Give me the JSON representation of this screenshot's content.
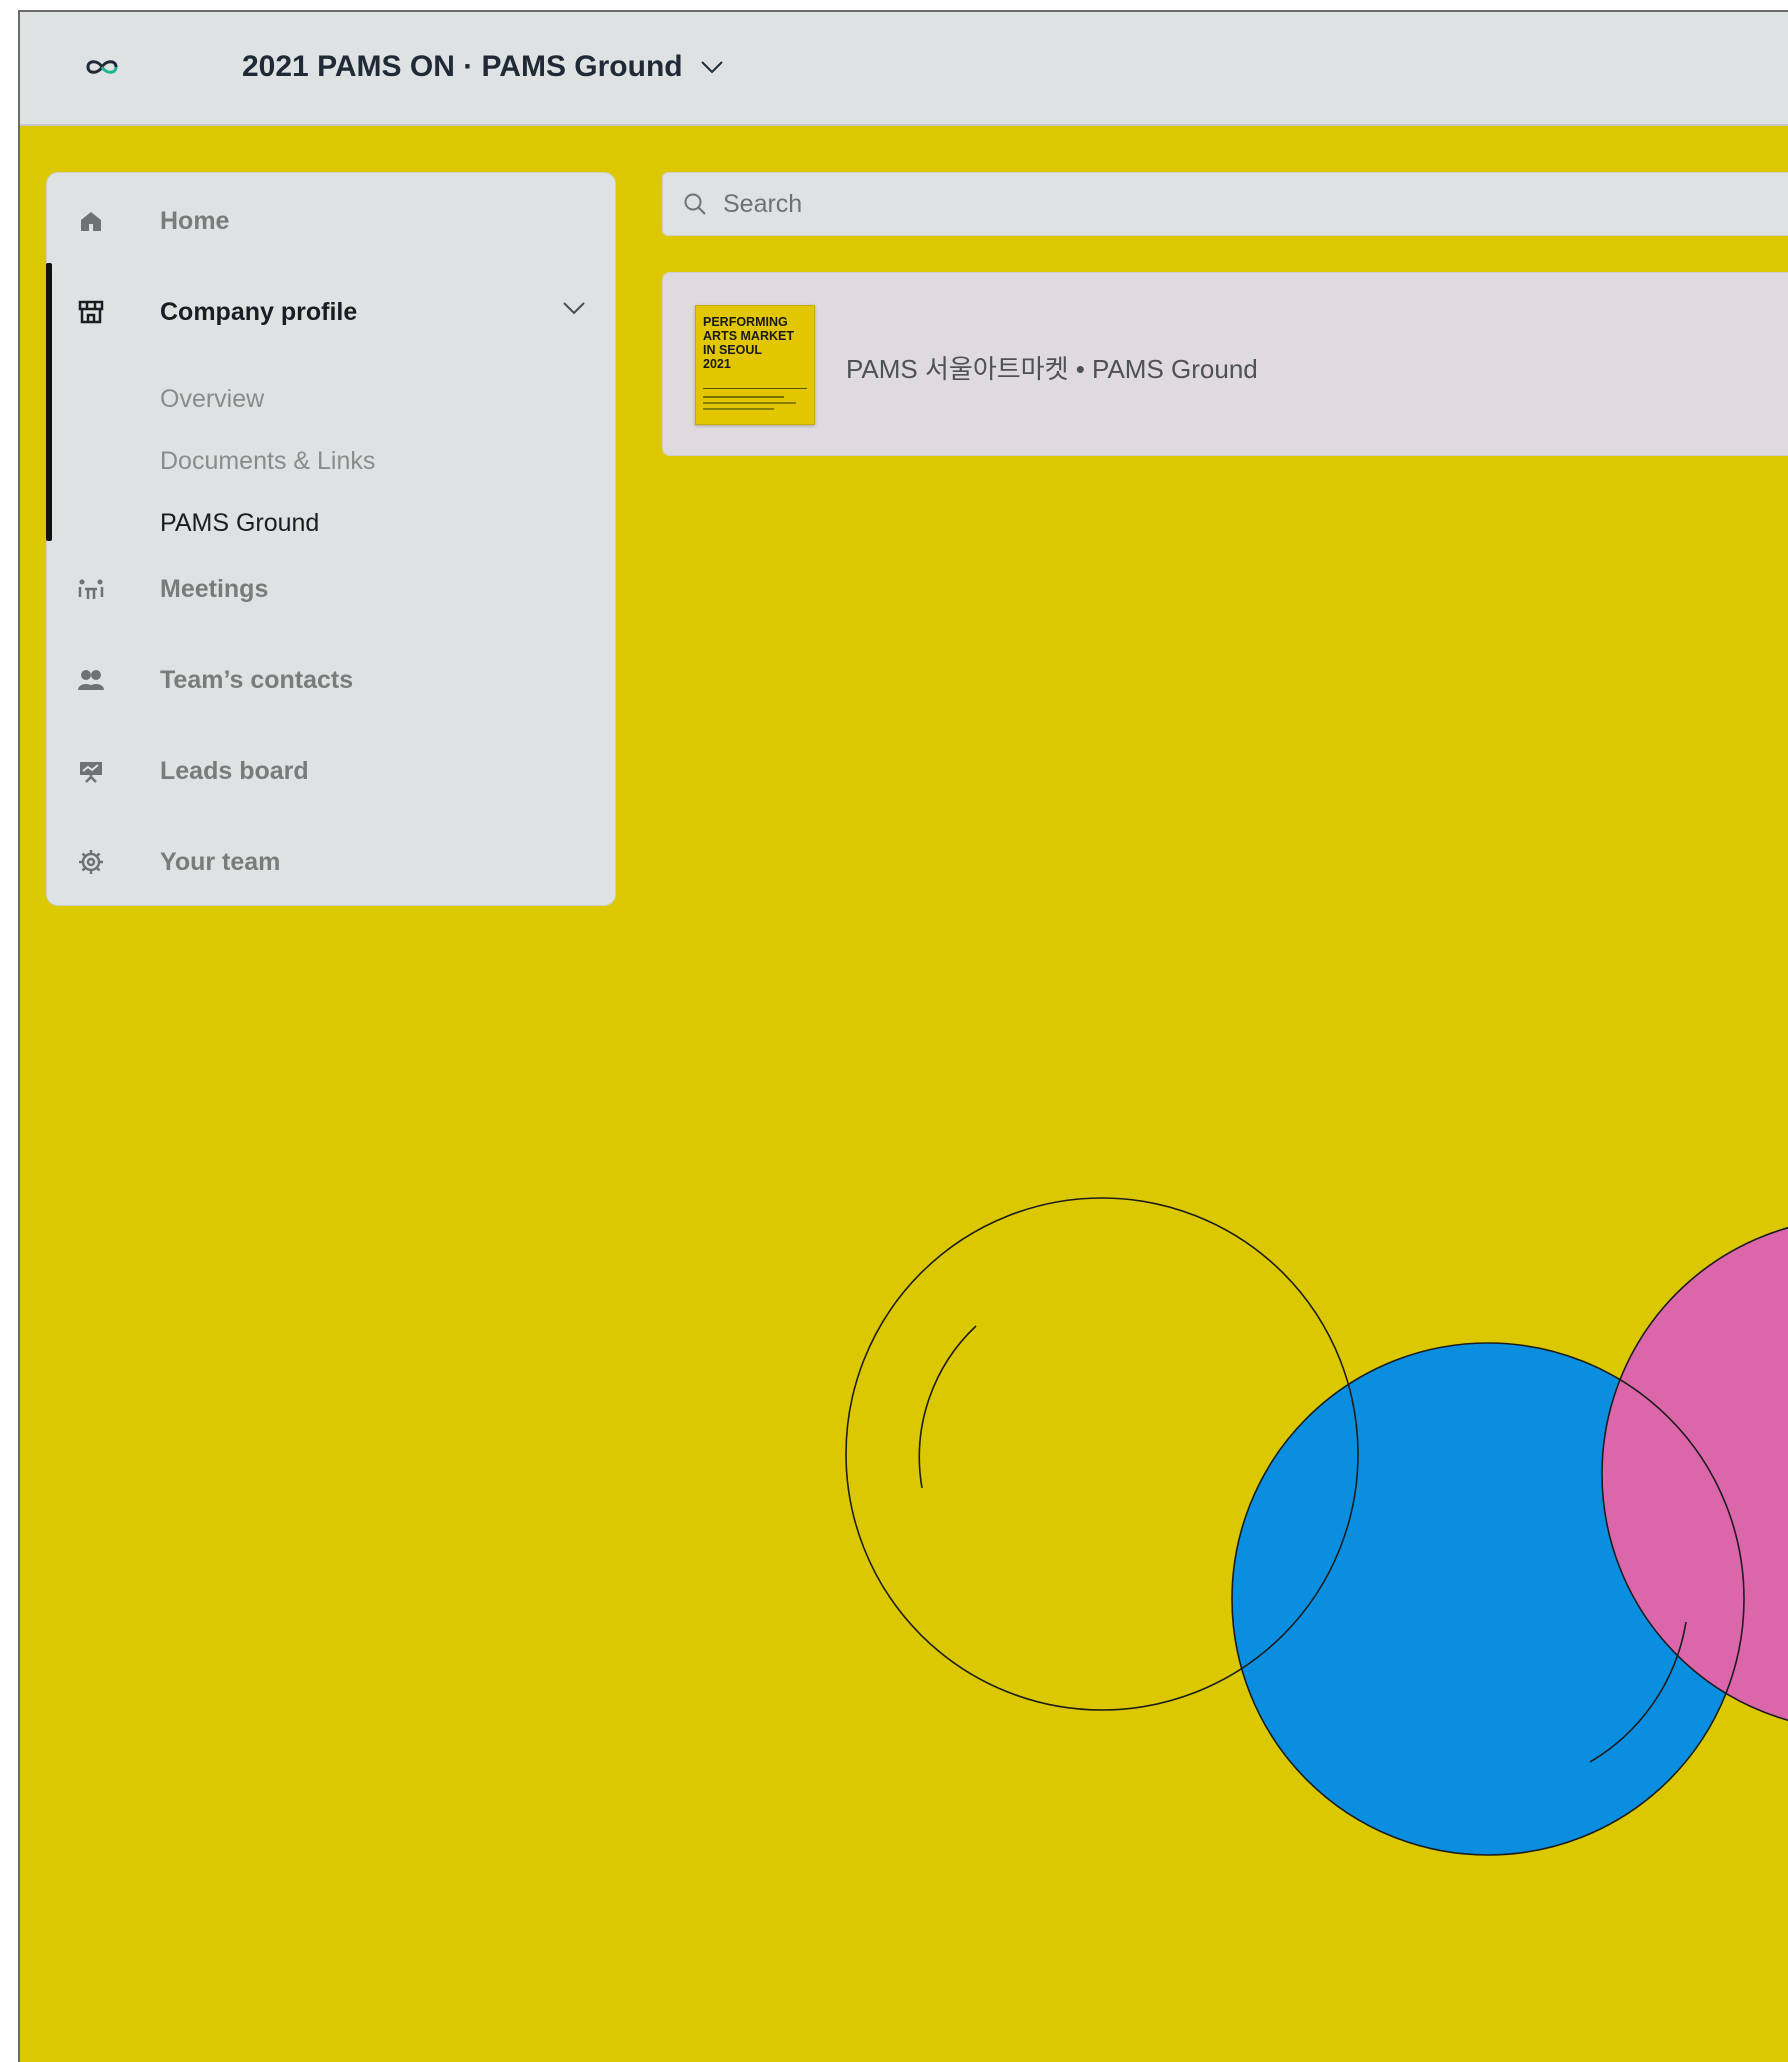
{
  "header": {
    "event_title": "2021 PAMS ON · PAMS Ground"
  },
  "sidebar": {
    "items": [
      {
        "label": "Home",
        "icon": "home-icon"
      },
      {
        "label": "Company profile",
        "icon": "storefront-icon"
      },
      {
        "label": "Meetings",
        "icon": "meetings-icon"
      },
      {
        "label": "Team’s contacts",
        "icon": "contacts-icon"
      },
      {
        "label": "Leads board",
        "icon": "leads-board-icon"
      },
      {
        "label": "Your team",
        "icon": "gear-icon"
      }
    ],
    "company_profile_subitems": [
      {
        "label": "Overview"
      },
      {
        "label": "Documents & Links"
      },
      {
        "label": "PAMS Ground"
      }
    ],
    "selected_subitem": "PAMS Ground"
  },
  "search": {
    "placeholder": "Search"
  },
  "card": {
    "title": "PAMS 서울아트마켓 • PAMS Ground",
    "poster_title": "PERFORMING\nARTS MARKET\nIN SEOUL\n2021"
  },
  "colors": {
    "background": "#dbc800",
    "panel": "#dfe2e2",
    "blue_circle": "#0a8ee0",
    "pink_circle": "#dc66aa",
    "logo_accent": "#1fb58f"
  }
}
